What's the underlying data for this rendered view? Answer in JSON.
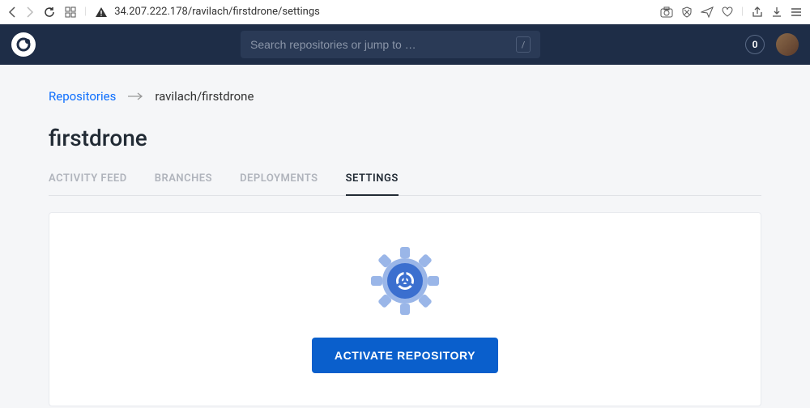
{
  "browser": {
    "url": "34.207.222.178/ravilach/firstdrone/settings"
  },
  "header": {
    "search_placeholder": "Search repositories or jump to …",
    "kbd_hint": "/",
    "count": "0"
  },
  "breadcrumb": {
    "root": "Repositories",
    "current": "ravilach/firstdrone"
  },
  "page_title": "firstdrone",
  "tabs": [
    {
      "label": "ACTIVITY FEED",
      "active": false
    },
    {
      "label": "BRANCHES",
      "active": false
    },
    {
      "label": "DEPLOYMENTS",
      "active": false
    },
    {
      "label": "SETTINGS",
      "active": true
    }
  ],
  "activate_button": "ACTIVATE REPOSITORY"
}
